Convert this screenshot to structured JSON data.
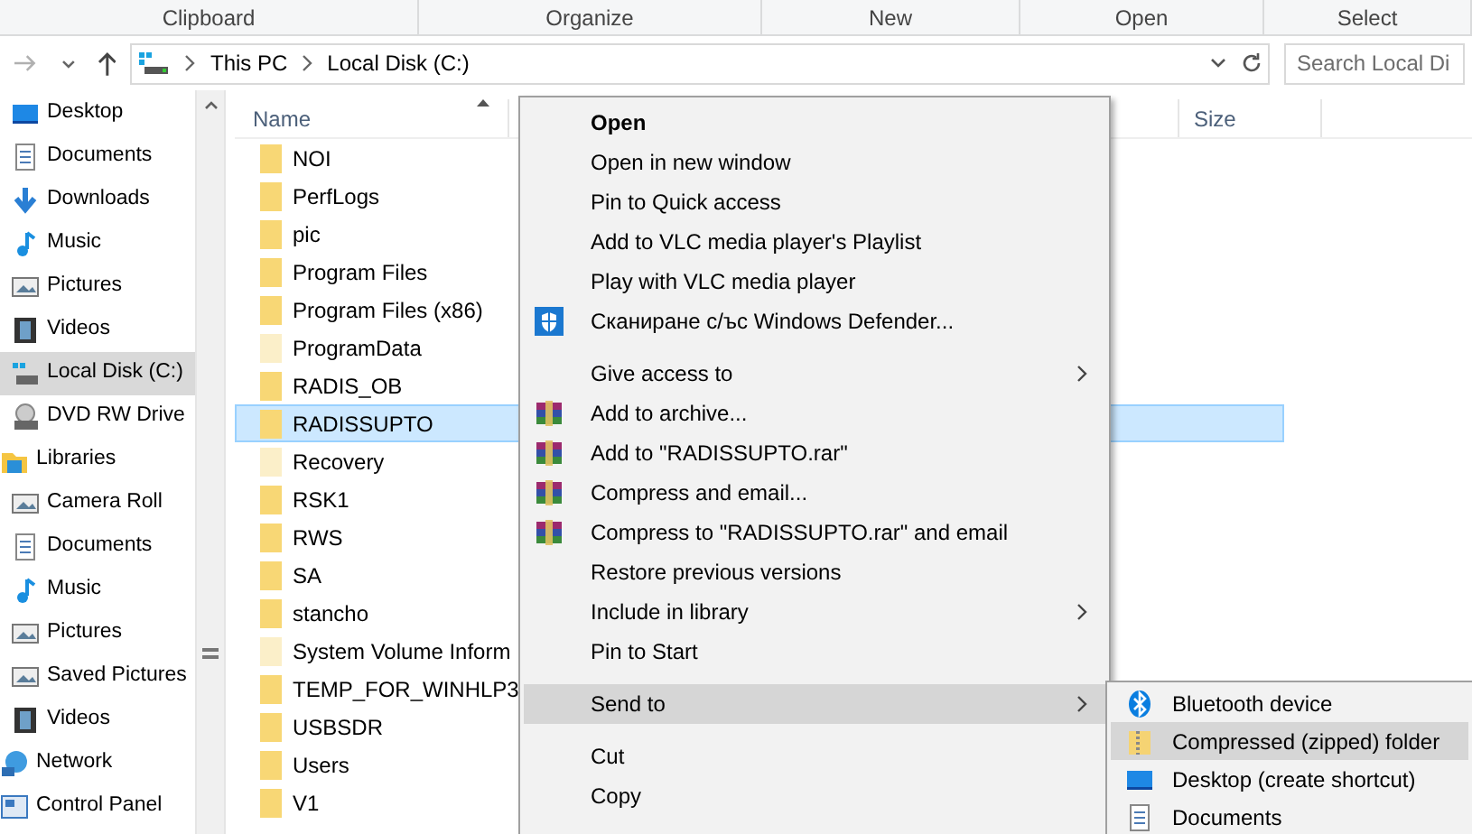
{
  "ribbon_groups": [
    "Clipboard",
    "Organize",
    "New",
    "Open",
    "Select"
  ],
  "address_bar": {
    "segments": [
      "This PC",
      "Local Disk (C:)"
    ],
    "search_placeholder": "Search Local Di"
  },
  "nav": {
    "continued_items": [
      {
        "label": "Desktop",
        "kind": "desktop",
        "selected": false
      },
      {
        "label": "Documents",
        "kind": "document",
        "selected": false
      },
      {
        "label": "Downloads",
        "kind": "download",
        "selected": false
      },
      {
        "label": "Music",
        "kind": "music",
        "selected": false
      },
      {
        "label": "Pictures",
        "kind": "picture",
        "selected": false
      },
      {
        "label": "Videos",
        "kind": "video",
        "selected": false
      },
      {
        "label": "Local Disk (C:)",
        "kind": "disk",
        "selected": true
      },
      {
        "label": "DVD RW Drive",
        "kind": "dvd",
        "selected": false
      }
    ],
    "items": [
      {
        "label": "Libraries",
        "kind": "library",
        "selected": false,
        "children": [
          {
            "label": "Camera Roll",
            "kind": "picture",
            "selected": false
          },
          {
            "label": "Documents",
            "kind": "document",
            "selected": false
          },
          {
            "label": "Music",
            "kind": "music",
            "selected": false
          },
          {
            "label": "Pictures",
            "kind": "picture",
            "selected": false
          },
          {
            "label": "Saved Pictures",
            "kind": "picture",
            "selected": false
          },
          {
            "label": "Videos",
            "kind": "video",
            "selected": false
          }
        ]
      },
      {
        "label": "Network",
        "kind": "network",
        "selected": false
      },
      {
        "label": "Control Panel",
        "kind": "control",
        "selected": false
      }
    ]
  },
  "file_list": {
    "columns": [
      "Name",
      "Size"
    ],
    "rows": [
      {
        "name": "NOI",
        "kind": "folder",
        "selected": false
      },
      {
        "name": "PerfLogs",
        "kind": "folder",
        "selected": false
      },
      {
        "name": "pic",
        "kind": "folder",
        "selected": false
      },
      {
        "name": "Program Files",
        "kind": "folder",
        "selected": false
      },
      {
        "name": "Program Files (x86)",
        "kind": "folder",
        "selected": false
      },
      {
        "name": "ProgramData",
        "kind": "hidden",
        "selected": false
      },
      {
        "name": "RADIS_OB",
        "kind": "folder",
        "selected": false
      },
      {
        "name": "RADISSUPTO",
        "kind": "folder",
        "selected": true
      },
      {
        "name": "Recovery",
        "kind": "hidden",
        "selected": false
      },
      {
        "name": "RSK1",
        "kind": "folder",
        "selected": false
      },
      {
        "name": "RWS",
        "kind": "folder",
        "selected": false
      },
      {
        "name": "SA",
        "kind": "folder",
        "selected": false
      },
      {
        "name": "stancho",
        "kind": "folder",
        "selected": false
      },
      {
        "name": "System Volume Inform",
        "kind": "hidden",
        "selected": false
      },
      {
        "name": "TEMP_FOR_WINHLP3",
        "kind": "folder",
        "selected": false
      },
      {
        "name": "USBSDR",
        "kind": "folder",
        "selected": false
      },
      {
        "name": "Users",
        "kind": "folder",
        "selected": false
      },
      {
        "name": "V1",
        "kind": "folder",
        "selected": false
      }
    ]
  },
  "context_menu": {
    "items": [
      {
        "kind": "plain",
        "label": "Open",
        "default": true,
        "submenu": false,
        "selected": false
      },
      {
        "kind": "plain",
        "label": "Open in new window",
        "default": false,
        "submenu": false,
        "selected": false
      },
      {
        "kind": "plain",
        "label": "Pin to Quick access",
        "default": false,
        "submenu": false,
        "selected": false
      },
      {
        "kind": "plain",
        "label": "Add to VLC media player's Playlist",
        "default": false,
        "submenu": false,
        "selected": false
      },
      {
        "kind": "plain",
        "label": "Play with VLC media player",
        "default": false,
        "submenu": false,
        "selected": false
      },
      {
        "kind": "shield",
        "label": "Сканиране с/ъс Windows Defender...",
        "default": false,
        "submenu": false,
        "selected": false
      },
      {
        "kind": "separator"
      },
      {
        "kind": "plain",
        "label": "Give access to",
        "default": false,
        "submenu": true,
        "selected": false
      },
      {
        "kind": "archive",
        "label": "Add to archive...",
        "default": false,
        "submenu": false,
        "selected": false
      },
      {
        "kind": "archive",
        "label": "Add to \"RADISSUPTO.rar\"",
        "default": false,
        "submenu": false,
        "selected": false
      },
      {
        "kind": "archive",
        "label": "Compress and email...",
        "default": false,
        "submenu": false,
        "selected": false
      },
      {
        "kind": "archive",
        "label": "Compress to \"RADISSUPTO.rar\" and email",
        "default": false,
        "submenu": false,
        "selected": false
      },
      {
        "kind": "plain",
        "label": "Restore previous versions",
        "default": false,
        "submenu": false,
        "selected": false
      },
      {
        "kind": "plain",
        "label": "Include in library",
        "default": false,
        "submenu": true,
        "selected": false
      },
      {
        "kind": "plain",
        "label": "Pin to Start",
        "default": false,
        "submenu": false,
        "selected": false
      },
      {
        "kind": "separator"
      },
      {
        "kind": "plain",
        "label": "Send to",
        "default": false,
        "submenu": true,
        "selected": true
      },
      {
        "kind": "separator"
      },
      {
        "kind": "plain",
        "label": "Cut",
        "default": false,
        "submenu": false,
        "selected": false
      },
      {
        "kind": "plain",
        "label": "Copy",
        "default": false,
        "submenu": false,
        "selected": false
      }
    ]
  },
  "send_to_menu": {
    "items": [
      {
        "label": "Bluetooth device",
        "kind": "bluetooth",
        "selected": false
      },
      {
        "label": "Compressed (zipped) folder",
        "kind": "zip",
        "selected": true
      },
      {
        "label": "Desktop (create shortcut)",
        "kind": "desktop",
        "selected": false
      },
      {
        "label": "Documents",
        "kind": "document",
        "selected": false
      }
    ]
  }
}
